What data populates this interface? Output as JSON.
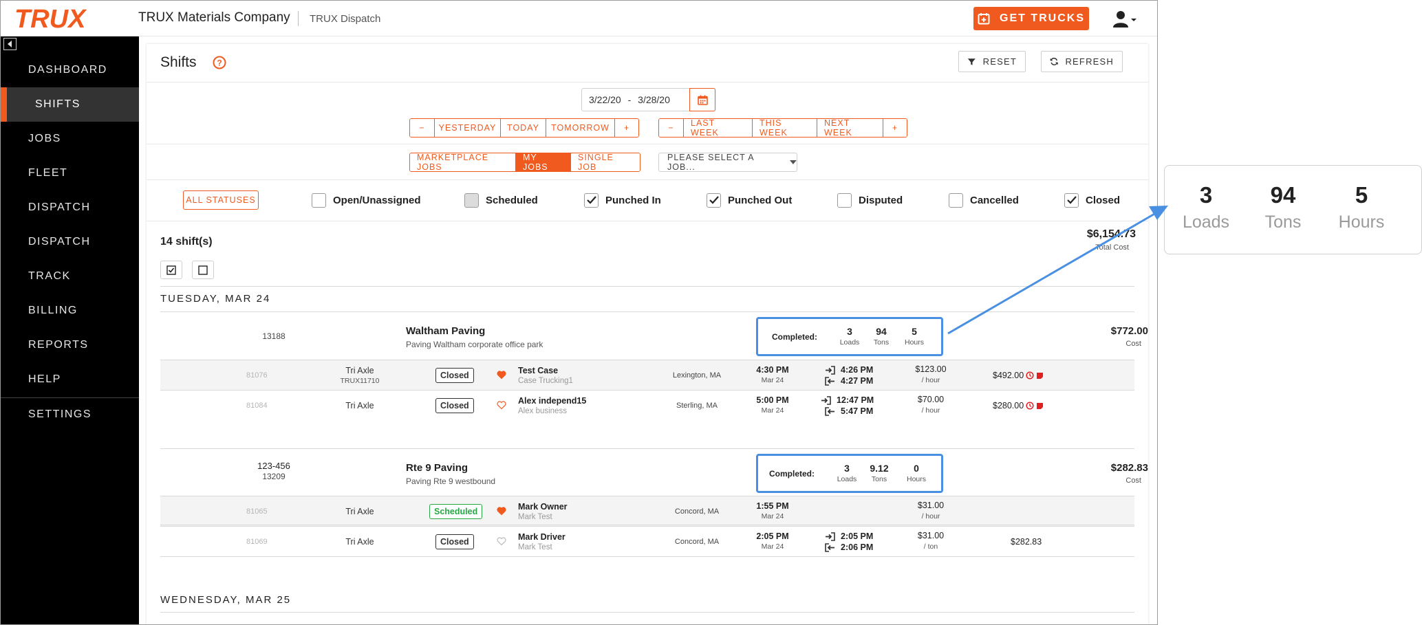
{
  "header": {
    "logo_text": "TRUX",
    "company": "TRUX Materials Company",
    "product": "TRUX Dispatch",
    "get_trucks_label": "GET TRUCKS"
  },
  "sidebar": {
    "items": [
      {
        "label": "DASHBOARD"
      },
      {
        "label": "SHIFTS"
      },
      {
        "label": "JOBS"
      },
      {
        "label": "FLEET"
      },
      {
        "label": "DISPATCH"
      },
      {
        "label": "DISPATCH"
      },
      {
        "label": "TRACK"
      },
      {
        "label": "BILLING"
      },
      {
        "label": "REPORTS"
      },
      {
        "label": "HELP"
      },
      {
        "label": "SETTINGS"
      }
    ],
    "active_index": 1
  },
  "page": {
    "title": "Shifts",
    "reset_label": "RESET",
    "refresh_label": "REFRESH",
    "date_start": "3/22/20",
    "date_sep": "-",
    "date_end": "3/28/20"
  },
  "day_buttons": [
    "−",
    "YESTERDAY",
    "TODAY",
    "TOMORROW",
    "+"
  ],
  "week_buttons": [
    "−",
    "LAST WEEK",
    "THIS WEEK",
    "NEXT WEEK",
    "+"
  ],
  "job_type_buttons": [
    "MARKETPLACE JOBS",
    "MY JOBS",
    "SINGLE JOB"
  ],
  "job_type_selected": "MY JOBS",
  "job_select_placeholder": "PLEASE SELECT A JOB...",
  "all_statuses_label": "ALL STATUSES",
  "statuses": [
    {
      "label": "Open/Unassigned",
      "checked": false
    },
    {
      "label": "Scheduled",
      "checked": false
    },
    {
      "label": "Punched In",
      "checked": true
    },
    {
      "label": "Punched Out",
      "checked": true
    },
    {
      "label": "Disputed",
      "checked": false
    },
    {
      "label": "Cancelled",
      "checked": false
    },
    {
      "label": "Closed",
      "checked": true
    }
  ],
  "summary": {
    "shift_count": "14 shift(s)",
    "total_cost": "$6,154.73",
    "total_cost_label": "Total Cost"
  },
  "days": [
    {
      "heading": "TUESDAY, MAR 24",
      "jobs": [
        {
          "id_line1": "13188",
          "id_line2": "",
          "name": "Waltham Paving",
          "description": "Paving Waltham corporate office park",
          "completed_label": "Completed:",
          "loads": "3",
          "loads_label": "Loads",
          "tons": "94",
          "tons_label": "Tons",
          "hours": "5",
          "hours_label": "Hours",
          "cost": "$772.00",
          "cost_label": "Cost",
          "shifts": [
            {
              "id": "81076",
              "truck": "Tri Axle",
              "plate": "TRUX11710",
              "status": "Closed",
              "favorite": true,
              "driver": "Test Case",
              "company": "Case Trucking1",
              "location": "Lexington, MA",
              "start": "4:30 PM",
              "date": "Mar 24",
              "punch_in": "4:26 PM",
              "punch_out": "4:27 PM",
              "rate": "$123.00",
              "rate_unit": "/ hour",
              "amount": "$492.00"
            },
            {
              "id": "81084",
              "truck": "Tri Axle",
              "plate": "",
              "status": "Closed",
              "favorite": false,
              "driver": "Alex independ15",
              "company": "Alex business",
              "location": "Sterling, MA",
              "start": "5:00 PM",
              "date": "Mar 24",
              "punch_in": "12:47 PM",
              "punch_out": "5:47 PM",
              "rate": "$70.00",
              "rate_unit": "/ hour",
              "amount": "$280.00"
            }
          ]
        },
        {
          "id_line1": "123-456",
          "id_line2": "13209",
          "name": "Rte 9 Paving",
          "description": "Paving Rte 9 westbound",
          "completed_label": "Completed:",
          "loads": "3",
          "loads_label": "Loads",
          "tons": "9.12",
          "tons_label": "Tons",
          "hours": "0",
          "hours_label": "Hours",
          "cost": "$282.83",
          "cost_label": "Cost",
          "shifts": [
            {
              "id": "81065",
              "truck": "Tri Axle",
              "plate": "",
              "status": "Scheduled",
              "favorite": true,
              "driver": "Mark Owner",
              "company": "Mark Test",
              "location": "Concord, MA",
              "start": "1:55 PM",
              "date": "Mar 24",
              "punch_in": "",
              "punch_out": "",
              "rate": "$31.00",
              "rate_unit": "/ hour",
              "amount": ""
            },
            {
              "id": "81069",
              "truck": "Tri Axle",
              "plate": "",
              "status": "Closed",
              "favorite": false,
              "driver": "Mark Driver",
              "company": "Mark Test",
              "location": "Concord, MA",
              "start": "2:05 PM",
              "date": "Mar 24",
              "punch_in": "2:05 PM",
              "punch_out": "2:06 PM",
              "rate": "$31.00",
              "rate_unit": "/ ton",
              "amount": "$282.83"
            }
          ]
        }
      ]
    },
    {
      "heading": "WEDNESDAY, MAR 25",
      "jobs": []
    }
  ],
  "zoom": {
    "loads": "3",
    "loads_label": "Loads",
    "tons": "94",
    "tons_label": "Tons",
    "hours": "5",
    "hours_label": "Hours"
  },
  "colors": {
    "accent": "#f05a1e",
    "sidebar_bg": "#000000",
    "sidebar_active": "#333333",
    "highlight_blue": "#4a90e2",
    "scheduled_green": "#27a844",
    "alert_red": "#e02020"
  }
}
